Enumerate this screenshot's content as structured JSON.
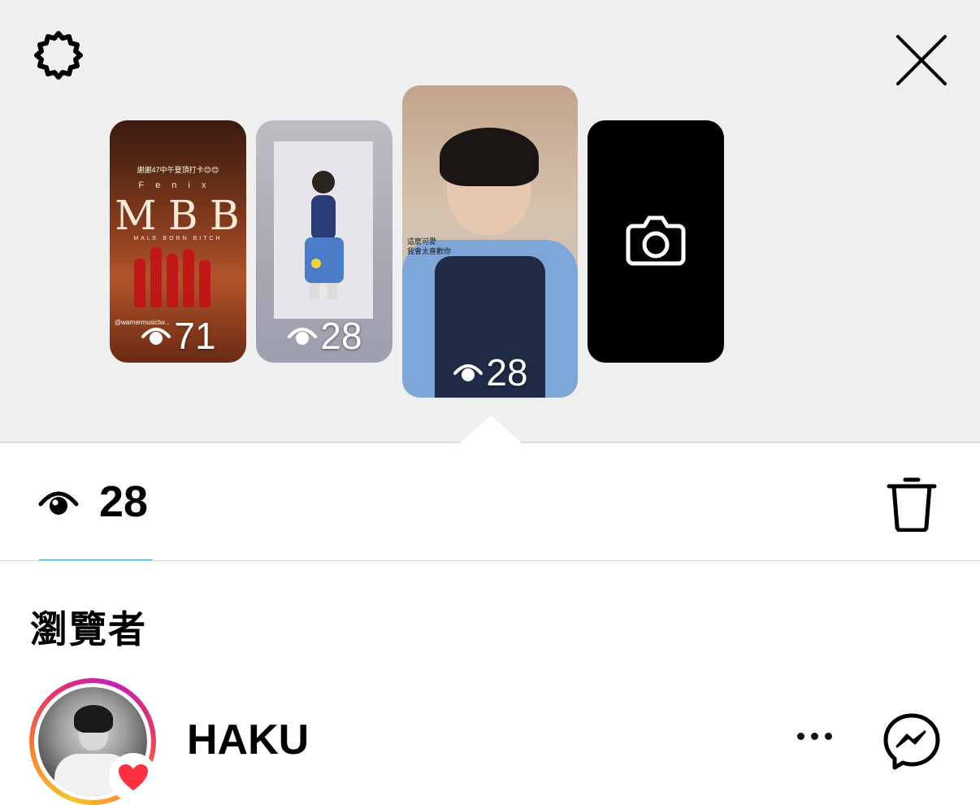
{
  "thumbnails": [
    {
      "id": "story-1",
      "views": "71"
    },
    {
      "id": "story-2",
      "views": "28"
    },
    {
      "id": "story-3",
      "views": "28",
      "selected": true
    },
    {
      "id": "camera-add"
    }
  ],
  "thumb1": {
    "title_line": "謝謝47中午登頂打卡😊😊",
    "logo_letters": [
      "M",
      "B",
      "B"
    ],
    "brand_top": "Fenix",
    "brand_sub": "MALE BORN BITCH",
    "footer": "@warnermusictw..."
  },
  "thumb3": {
    "caption": "這麼可愛\n我會太喜歡你"
  },
  "stats": {
    "view_count": "28"
  },
  "section": {
    "viewers_title": "瀏覽者"
  },
  "viewers": [
    {
      "name": "HAKU",
      "liked": true
    }
  ],
  "colors": {
    "background_top": "#efefef",
    "heart": "#ff3040",
    "underline": "#3fa3c7"
  }
}
